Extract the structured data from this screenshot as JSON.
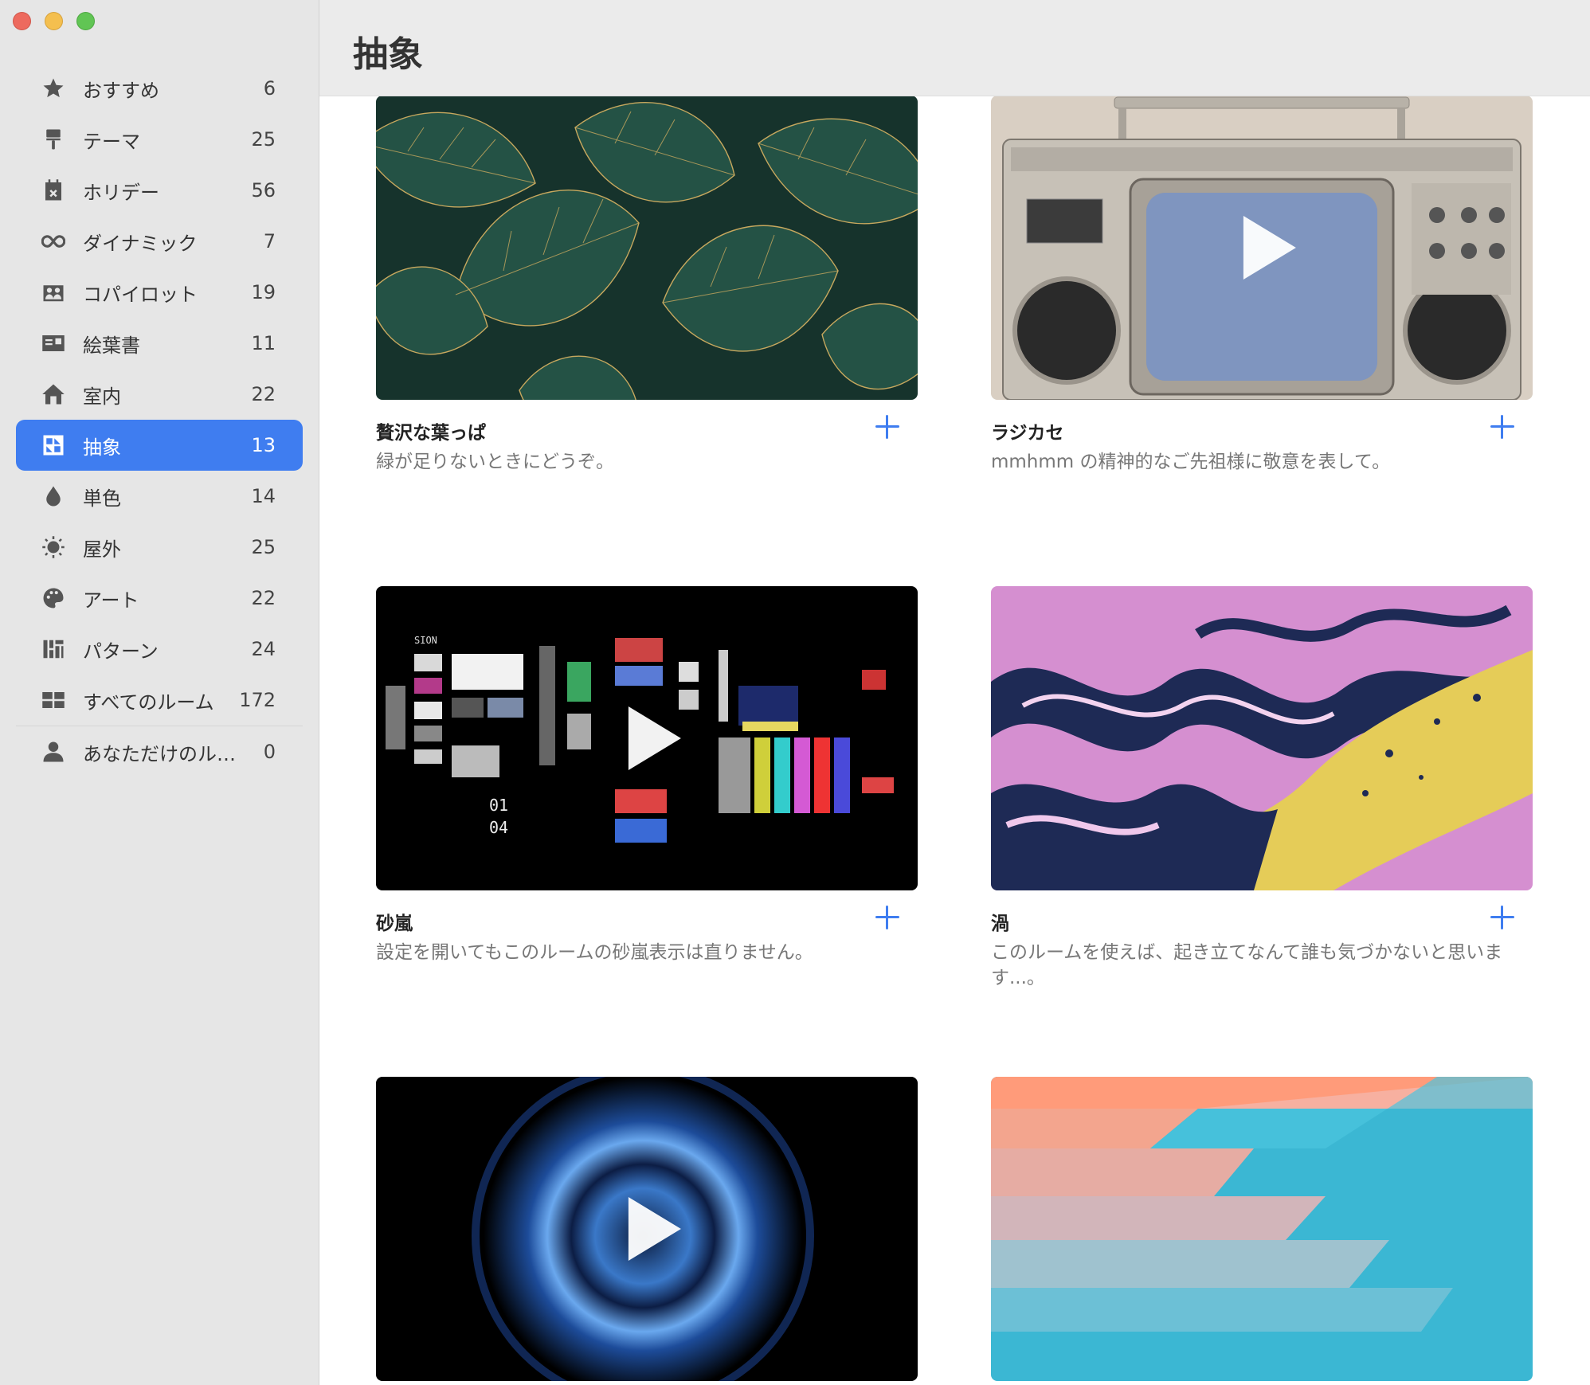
{
  "window": {
    "title": "抽象"
  },
  "sidebar": {
    "items": [
      {
        "label": "おすすめ",
        "count": "6",
        "icon": "star-icon"
      },
      {
        "label": "テーマ",
        "count": "25",
        "icon": "paint-roller-icon"
      },
      {
        "label": "ホリデー",
        "count": "56",
        "icon": "calendar-icon"
      },
      {
        "label": "ダイナミック",
        "count": "7",
        "icon": "infinity-icon"
      },
      {
        "label": "コパイロット",
        "count": "19",
        "icon": "people-icon"
      },
      {
        "label": "絵葉書",
        "count": "11",
        "icon": "postcard-icon"
      },
      {
        "label": "室内",
        "count": "22",
        "icon": "house-icon"
      },
      {
        "label": "抽象",
        "count": "13",
        "icon": "abstract-icon"
      },
      {
        "label": "単色",
        "count": "14",
        "icon": "drop-icon"
      },
      {
        "label": "屋外",
        "count": "25",
        "icon": "sun-icon"
      },
      {
        "label": "アート",
        "count": "22",
        "icon": "palette-icon"
      },
      {
        "label": "パターン",
        "count": "24",
        "icon": "pattern-icon"
      },
      {
        "label": "すべてのルーム",
        "count": "172",
        "icon": "grid-icon"
      },
      {
        "label": "あなただけのル…",
        "count": "0",
        "icon": "person-icon"
      }
    ],
    "active_index": 7
  },
  "cards": [
    {
      "title": "贅沢な葉っぱ",
      "description": "緑が足りないときにどうぞ。",
      "video": false
    },
    {
      "title": "ラジカセ",
      "description": "mmhmm の精神的なご先祖様に敬意を表して。",
      "video": true
    },
    {
      "title": "砂嵐",
      "description": "設定を開いてもこのルームの砂嵐表示は直りません。",
      "video": true
    },
    {
      "title": "渦",
      "description": "このルームを使えば、起き立てなんて誰も気づかないと思います...。",
      "video": false
    },
    {
      "title": "",
      "description": "",
      "video": true
    },
    {
      "title": "",
      "description": "",
      "video": false
    }
  ],
  "colors": {
    "accent": "#3f7df0",
    "sidebar_bg": "#e6e6e6",
    "header_bg": "#ebebeb"
  }
}
